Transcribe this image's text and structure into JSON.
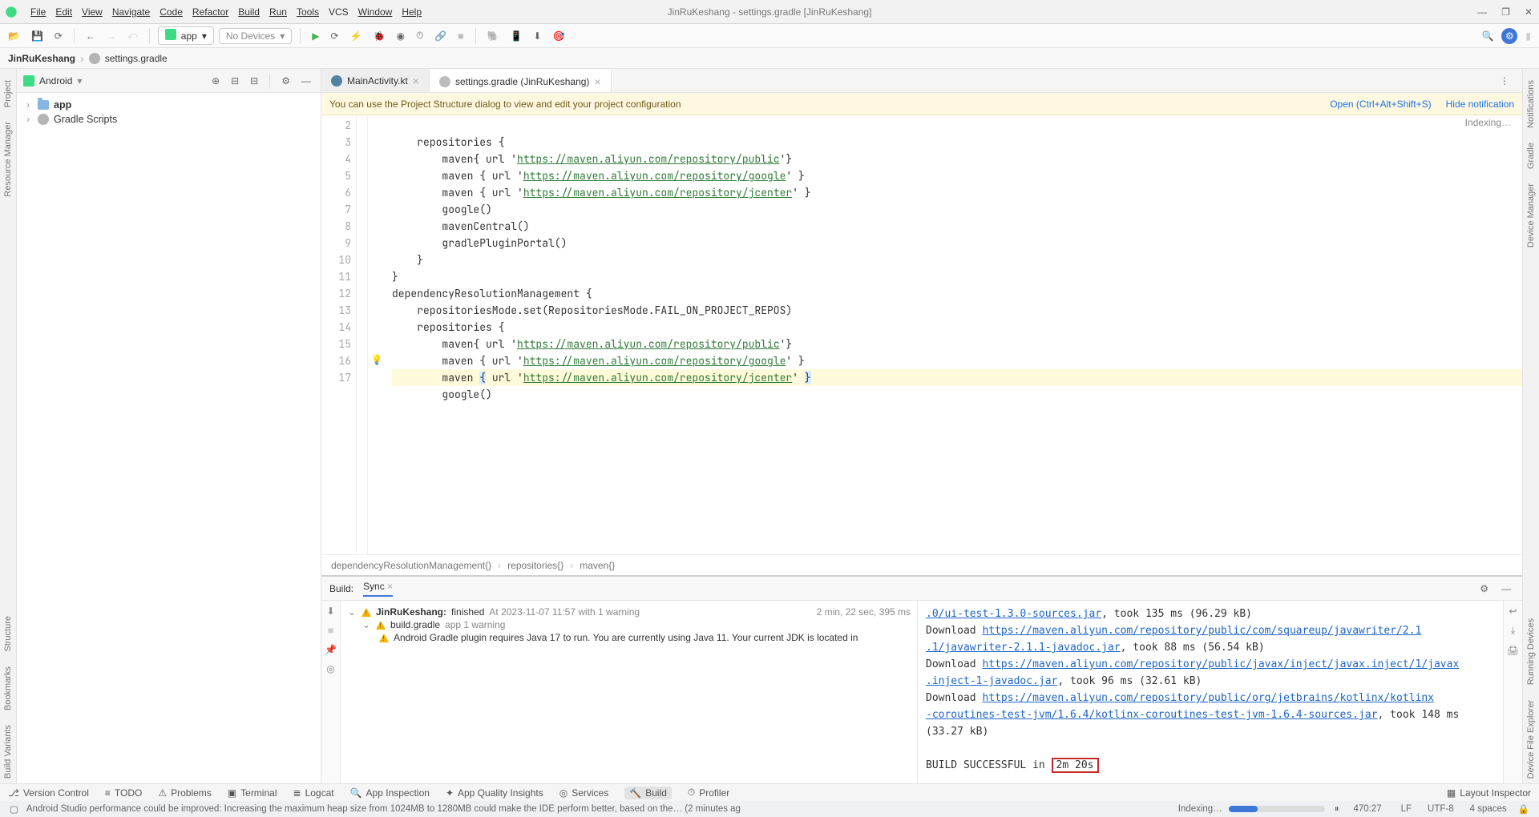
{
  "window": {
    "title": "JinRuKeshang - settings.gradle [JinRuKeshang]"
  },
  "menu": {
    "file": "File",
    "edit": "Edit",
    "view": "View",
    "navigate": "Navigate",
    "code": "Code",
    "refactor": "Refactor",
    "build": "Build",
    "run": "Run",
    "tools": "Tools",
    "vcs": "VCS",
    "window": "Window",
    "help": "Help"
  },
  "toolbar": {
    "config_label": "app",
    "device_label": "No Devices"
  },
  "breadcrumb": {
    "root": "JinRuKeshang",
    "file": "settings.gradle"
  },
  "project": {
    "title": "Android",
    "app_label": "app",
    "scripts_label": "Gradle Scripts"
  },
  "tabs": {
    "t1": "MainActivity.kt",
    "t2": "settings.gradle (JinRuKeshang)",
    "indexing": "Indexing…"
  },
  "banner": {
    "text": "You can use the Project Structure dialog to view and edit your project configuration",
    "open": "Open (Ctrl+Alt+Shift+S)",
    "hide": "Hide notification"
  },
  "code": {
    "lines": [
      "2",
      "3",
      "4",
      "5",
      "6",
      "7",
      "8",
      "9",
      "10",
      "11",
      "12",
      "13",
      "14",
      "15",
      "16",
      "17"
    ],
    "l2": "    repositories {",
    "l3_pre": "        maven{ url '",
    "l3_url": "https://maven.aliyun.com/repository/public",
    "l3_post": "'}",
    "l4_pre": "        maven { url '",
    "l4_url": "https://maven.aliyun.com/repository/google",
    "l4_post": "' }",
    "l5_pre": "        maven { url '",
    "l5_url": "https://maven.aliyun.com/repository/jcenter",
    "l5_post": "' }",
    "l6": "        google()",
    "l7": "        mavenCentral()",
    "l8": "        gradlePluginPortal()",
    "l9": "    }",
    "l10": "}",
    "l11": "dependencyResolutionManagement {",
    "l12": "    repositoriesMode.set(RepositoriesMode.FAIL_ON_PROJECT_REPOS)",
    "l13": "    repositories {",
    "l14_pre": "        maven{ url '",
    "l14_url": "https://maven.aliyun.com/repository/public",
    "l14_post": "'}",
    "l15_pre": "        maven { url '",
    "l15_url": "https://maven.aliyun.com/repository/google",
    "l15_post": "' }",
    "l16_pre": "        maven ",
    "l16_brace1": "{",
    "l16_mid": " url '",
    "l16_url": "https://maven.aliyun.com/repository/jcenter",
    "l16_post": "' ",
    "l16_brace2": "}",
    "l17": "        google()"
  },
  "crumb2": {
    "c1": "dependencyResolutionManagement{}",
    "c2": "repositories{}",
    "c3": "maven{}"
  },
  "build": {
    "tab_build": "Build:",
    "tab_sync": "Sync",
    "left": {
      "root_name": "JinRuKeshang:",
      "root_status": "finished",
      "root_time": "At 2023-11-07 11:57 with 1 warning",
      "root_right": "2 min, 22 sec, 395 ms",
      "bg_name": "build.gradle",
      "bg_sub": "app 1 warning",
      "bg_msg": "Android Gradle plugin requires Java 17 to run. You are currently using Java 11. Your current JDK is located in"
    },
    "right": {
      "r1a": ".0/ui-test-1.3.0-sources.jar",
      "r1b": ", took 135 ms (96.29 kB)",
      "r2pre": "Download ",
      "r2a": "https://maven.aliyun.com/repository/public/com/squareup/javawriter/2.1",
      "r2b": ".1/javawriter-2.1.1-javadoc.jar",
      "r2c": ", took 88 ms (56.54 kB)",
      "r3pre": "Download ",
      "r3a": "https://maven.aliyun.com/repository/public/javax/inject/javax.inject/1/javax",
      "r3b": ".inject-1-javadoc.jar",
      "r3c": ", took 96 ms (32.61 kB)",
      "r4pre": "Download ",
      "r4a": "https://maven.aliyun.com/repository/public/org/jetbrains/kotlinx/kotlinx",
      "r4b": "-coroutines-test-jvm/1.6.4/kotlinx-coroutines-test-jvm-1.6.4-sources.jar",
      "r4c": ", took 148 ms",
      "r4d": "(33.27 kB)",
      "r5pre": "BUILD SUCCESSFUL in ",
      "r5box": "2m 20s"
    }
  },
  "bottom_tools": {
    "vcs": "Version Control",
    "todo": "TODO",
    "problems": "Problems",
    "terminal": "Terminal",
    "logcat": "Logcat",
    "appinsp": "App Inspection",
    "quality": "App Quality Insights",
    "services": "Services",
    "build": "Build",
    "profiler": "Profiler",
    "layout": "Layout Inspector"
  },
  "status": {
    "hint": "Android Studio performance could be improved: Increasing the maximum heap size from 1024MB to 1280MB could make the IDE perform better, based on the… (2 minutes ag",
    "indexing": "Indexing…",
    "caret": "470:27",
    "lf": "LF",
    "enc": "UTF-8",
    "spaces": "4 spaces"
  },
  "left_labels": {
    "project": "Project",
    "rm": "Resource Manager"
  },
  "right_labels": {
    "notif": "Notifications",
    "gradle": "Gradle",
    "devmgr": "Device Manager"
  },
  "left_bottom_labels": {
    "structure": "Structure",
    "bookmarks": "Bookmarks",
    "bv": "Build Variants"
  },
  "right_bottom_labels": {
    "rd": "Running Devices",
    "dfe": "Device File Explorer"
  }
}
